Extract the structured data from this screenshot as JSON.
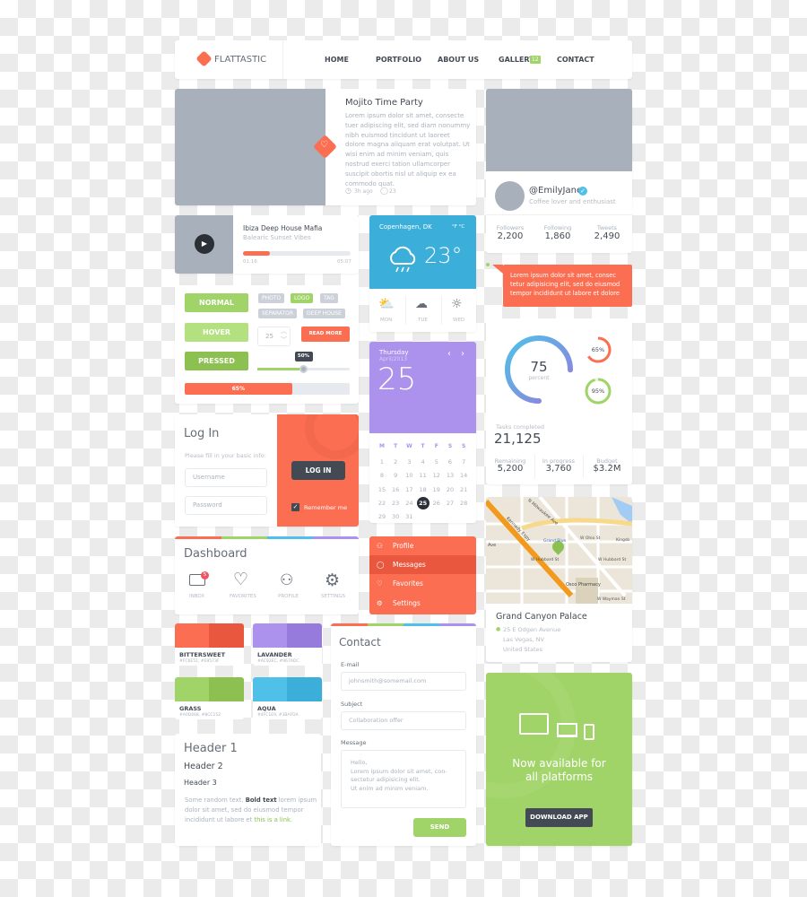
{
  "nav": {
    "brand": "FLATTASTIC",
    "items": [
      "HOME",
      "PORTFOLIO",
      "ABOUT US",
      "GALLERY",
      "CONTACT"
    ],
    "gallery_badge": "12"
  },
  "blog": {
    "title": "Mojito Time Party",
    "body": "Lorem ipsum dolor sit amet, consecte tuer adipiscing elit, sed diam nonummy nibh euismod tincidunt ut laoreet dolore magna aliquam erat volutpat. Ut wisi enim ad minim veniam, quis nostrud exerci tation ullamcorper suscipit obortis nisl ut aliquip ex ea commodo quat.",
    "time": "3h ago",
    "comments": "23"
  },
  "profile": {
    "handle": "@EmilyJane",
    "bio": "Coffee lover and enthusiast",
    "stats": [
      {
        "label": "Followers",
        "value": "2,200"
      },
      {
        "label": "Following",
        "value": "1,860"
      },
      {
        "label": "Tweets",
        "value": "2,490"
      }
    ]
  },
  "player": {
    "title": "Ibiza Deep House Mafia",
    "subtitle": "Balearic Sunset Vibes",
    "elapsed": "01:16",
    "total": "05:07",
    "progress": 0.25
  },
  "weather": {
    "city": "Copenhagen, DK",
    "units": "°F  °C",
    "temp": "23°",
    "days": [
      "MON",
      "TUE",
      "WED"
    ]
  },
  "tooltip": {
    "text": "Lorem ipsum dolor sit amet, consec tetur adipisicing elit, sed do eiusmod tempor incididunt ut labore et dolore"
  },
  "controls": {
    "buttons": [
      "NORMAL",
      "HOVER",
      "PRESSED"
    ],
    "tags": [
      "PHOTO",
      "LOGO",
      "TAG",
      "SEPARATOR",
      "DEEP HOUSE"
    ],
    "stepper": "25",
    "read_more": "READ MORE",
    "slider_label": "50%",
    "slider_value": 50,
    "progress_label": "65%",
    "progress_value": 65
  },
  "calendar": {
    "weekday": "Thursday",
    "month_year": "April/2013",
    "day": "25",
    "headers": [
      "M",
      "T",
      "W",
      "T",
      "F",
      "S",
      "S"
    ],
    "selected": 25,
    "days_in_month": 31
  },
  "stats": {
    "main_value": "75",
    "main_label": "percent",
    "main_percent": 75,
    "small": [
      {
        "label": "65%",
        "percent": 65
      },
      {
        "label": "95%",
        "percent": 95
      }
    ],
    "tasks_label": "Tasks completed",
    "tasks_value": "21,125",
    "row": [
      {
        "label": "Remaining",
        "value": "5,200"
      },
      {
        "label": "In progress",
        "value": "3,760"
      },
      {
        "label": "Budget",
        "value": "$3.2M"
      }
    ]
  },
  "login": {
    "title": "Log In",
    "hint": "Please fill in your basic info:",
    "username_ph": "Username",
    "password_ph": "Password",
    "button": "LOG IN",
    "remember": "Remember me",
    "remember_checked": true
  },
  "map": {
    "title": "Grand Canyon Palace",
    "address": [
      "25 E Odgen Avenue",
      "Las Vegas, NV",
      "United States"
    ],
    "labels": [
      "N Milwaukee Ave",
      "Kennedy Expy",
      "W Ohio St",
      "Kingsb",
      "Grand Blue",
      "W Hubbard St",
      "W Hubbard St",
      "Osco Pharmacy",
      "W Wayman St",
      "Ave"
    ]
  },
  "dashboard": {
    "title": "Dashboard",
    "items": [
      "INBOX",
      "FAVORITES",
      "PROFILE",
      "SETTINGS"
    ],
    "inbox_badge": "5"
  },
  "menu": {
    "items": [
      "Profile",
      "Messages",
      "Favorites",
      "Settings"
    ],
    "active": 1
  },
  "swatches": [
    {
      "name": "BITTERSWEET",
      "hex": "#FC6E51, #E9573F",
      "c1": "#FC6E51",
      "c2": "#E9573F"
    },
    {
      "name": "LAVANDER",
      "hex": "#AC92EC, #967ADC",
      "c1": "#AC92EC",
      "c2": "#967ADC"
    },
    {
      "name": "GRASS",
      "hex": "#A0D468, #8CC152",
      "c1": "#A0D468",
      "c2": "#8CC152"
    },
    {
      "name": "AQUA",
      "hex": "#4FC1E9, #3BAFDA",
      "c1": "#4FC1E9",
      "c2": "#3BAFDA"
    }
  ],
  "contact": {
    "title": "Contact",
    "email_label": "E-mail",
    "email_ph": "johnsmith@somemail.com",
    "subject_label": "Subject",
    "subject_ph": "Collaboration offer",
    "message_label": "Message",
    "message_lines": [
      "Hello,",
      "Lorem ipsum dolor sit amet, con-",
      "sectetur adipisicing elit.",
      "Ut enim ad minim veniam."
    ],
    "send": "SEND"
  },
  "typography": {
    "h1": "Header 1",
    "h2": "Header 2",
    "h3": "Header 3",
    "text_a": "Some random text. ",
    "bold": "Bold text",
    "text_b": " lorem ipsum dolor sit amet, sed do eiusmod tempor incididunt ut labore et ",
    "link": "this is a link",
    "text_c": "."
  },
  "promo": {
    "line1": "Now available for",
    "line2": "all platforms",
    "button": "DOWNLOAD APP"
  },
  "colors": {
    "orange": "#FC6E51",
    "green": "#A0D468",
    "aqua": "#4FC1E9",
    "lavender": "#AC92EC",
    "dark": "#434A54"
  }
}
